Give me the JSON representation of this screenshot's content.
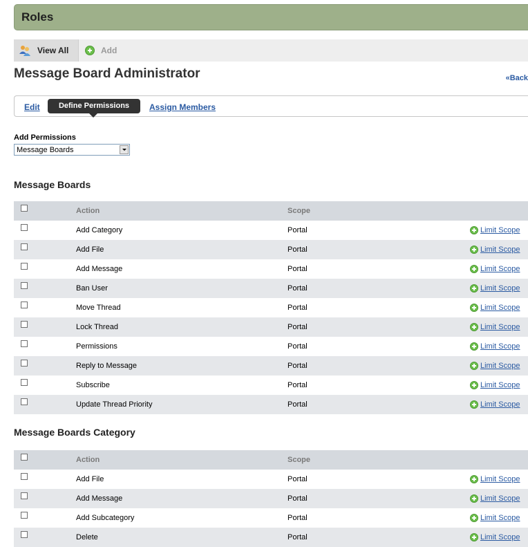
{
  "header": {
    "title": "Roles"
  },
  "nav": {
    "view_all": "View All",
    "add": "Add"
  },
  "page": {
    "title": "Message Board Administrator",
    "back": "«Back"
  },
  "tabs": {
    "edit": "Edit",
    "define": "Define Permissions",
    "assign": "Assign Members"
  },
  "add_permissions": {
    "label": "Add Permissions",
    "selected": "Message Boards"
  },
  "section1": {
    "title": "Message Boards",
    "col_action": "Action",
    "col_scope": "Scope",
    "rows": [
      {
        "action": "Add Category",
        "scope": "Portal",
        "link": "Limit Scope"
      },
      {
        "action": "Add File",
        "scope": "Portal",
        "link": "Limit Scope"
      },
      {
        "action": "Add Message",
        "scope": "Portal",
        "link": "Limit Scope"
      },
      {
        "action": "Ban User",
        "scope": "Portal",
        "link": "Limit Scope"
      },
      {
        "action": "Move Thread",
        "scope": "Portal",
        "link": "Limit Scope"
      },
      {
        "action": "Lock Thread",
        "scope": "Portal",
        "link": "Limit Scope"
      },
      {
        "action": "Permissions",
        "scope": "Portal",
        "link": "Limit Scope"
      },
      {
        "action": "Reply to Message",
        "scope": "Portal",
        "link": "Limit Scope"
      },
      {
        "action": "Subscribe",
        "scope": "Portal",
        "link": "Limit Scope"
      },
      {
        "action": "Update Thread Priority",
        "scope": "Portal",
        "link": "Limit Scope"
      }
    ]
  },
  "section2": {
    "title": "Message Boards Category",
    "col_action": "Action",
    "col_scope": "Scope",
    "rows": [
      {
        "action": "Add File",
        "scope": "Portal",
        "link": "Limit Scope"
      },
      {
        "action": "Add Message",
        "scope": "Portal",
        "link": "Limit Scope"
      },
      {
        "action": "Add Subcategory",
        "scope": "Portal",
        "link": "Limit Scope"
      },
      {
        "action": "Delete",
        "scope": "Portal",
        "link": "Limit Scope"
      }
    ]
  },
  "colors": {
    "title_bar": "#9eb08a",
    "link": "#2a5aa2",
    "header_row": "#d5d9de",
    "alt_row": "#e5e7ea"
  }
}
